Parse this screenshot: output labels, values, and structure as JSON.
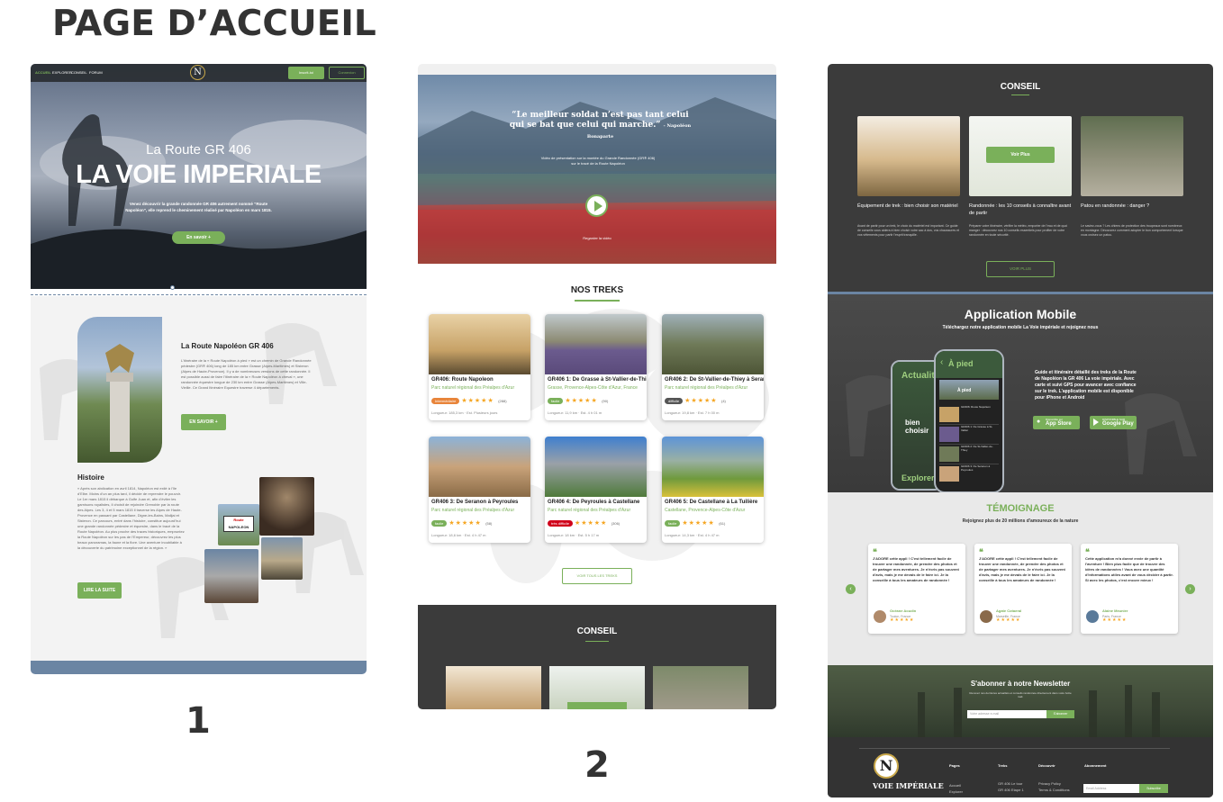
{
  "page_title": "PAGE D’ACCUEIL",
  "labels": {
    "one": "1",
    "two": "2"
  },
  "p1": {
    "nav": [
      "ACCUEIL",
      "EXPLORER",
      "CONSEIL",
      "FORUM"
    ],
    "logo": "N",
    "btn_signup": "Inscrit-toi",
    "btn_login": "Connexion",
    "hero_sub": "La Route GR 406",
    "hero_title": "LA VOIE IMPERIALE",
    "hero_text": "Venez découvrir la grande randonnée GR 406 autrement nommé “Route Napoléon”, elle reprend le cheminement réalisé par Napoléon en mars 1815.",
    "hero_btn": "En savoir +",
    "about_title": "La Route Napoléon GR 406",
    "about_text": "L’itinéraire de la « Route Napoléon à pied » est un chemin de Grande Randonnée pédestre (GR® 406) long de 185 km entre Grasse (Alpes-Maritimes) et Sisteron (Alpes de Haute-Provence). Il y a de nombreuses versions de cette randonnée. Il est possible aussi de faire l’itinéraire de la « Route Napoléon à cheval », une randonnée équestre longue de 230 km entre Grasse (Alpes-Maritimes) et Ville-Vieille. Ce Grand Itinéraire Equestre traverse 4 départements.",
    "about_btn": "EN SAVOIR +",
    "hist_title": "Histoire",
    "hist_text": "« Après son abdication en avril 1814, Napoléon est exilé à l’île d’Elbe. Moins d’un an plus tard, il décide de reprendre le pouvoir. Le 1er mars 1815 il débarque à Golfe Juan et, afin d’éviter les garnisons royalistes, il choisit de rejoindre Grenoble par la route des Alpes. Les 3, 4 et 5 mars 1815 il traverse les Alpes de Haute-Provence en passant par Castellane, Digne-les-Bains, Malijai et Sisteron. Ce parcours, entré dans l’histoire, constitue aujourd’hui une grande randonnée pédestre et équestre, dans le tracé de la Route Napoléon. Au plus proche des traces historiques, empruntez la Route Napoléon sur les pas de l’Empereur, découvrez les plus beaux panoramas, la faune et la flore. Une aventure inoubliable à la découverte du patrimoine exceptionnel de la région. »",
    "hist_btn": "LIRE LA SUITE",
    "sign_line1": "Route",
    "sign_line2": "NAPOLEON"
  },
  "p2": {
    "quote": "“Le meilleur soldat n’est pas tant celui qui se bat que celui qui marche.”",
    "quote_author": "- Napoléon Bonaparte",
    "video_caption": "Vidéo de présentation sur la montée du Grande Randonnée (GR® 406) sur le tracé de la Route Napoléon",
    "video_label": "Regarder la vidéo",
    "treks_title": "NOS TREKS",
    "treks": [
      {
        "title": "GR406: Route Napoleon",
        "region": "Parc naturel régional des Préalpes d'Azur",
        "level": "Intermédiaire",
        "level_color": "#e8843a",
        "rating": "(288)",
        "meta": "Longueur: 185,3 km · Est. Plusieurs jours"
      },
      {
        "title": "GR406 1: De Grasse à St-Vallier-de-Thiey",
        "region": "Grasse, Provence-Alpes-Côte d'Azur, France",
        "level": "facile",
        "level_color": "#7ab05a",
        "rating": "(90)",
        "meta": "Longueur: 11,9 km · Est. 4 h 01 m"
      },
      {
        "title": "GR406 2: De St-Vallier-de-Thiey à Seranon",
        "region": "Parc naturel régional des Préalpes d'Azur",
        "level": "difficile",
        "level_color": "#555555",
        "rating": "(4)",
        "meta": "Longueur: 19,8 km · Est. 7 h 00 m"
      },
      {
        "title": "GR406 3: De Seranon à Peyroules",
        "region": "Parc naturel régional des Préalpes d'Azur",
        "level": "facile",
        "level_color": "#7ab05a",
        "rating": "(58)",
        "meta": "Longueur: 18,6 km · Est. 4 h 47 m"
      },
      {
        "title": "GR406 4: De Peyroules à Castellane",
        "region": "Parc naturel régional des Préalpes d'Azur",
        "level": "très difficile",
        "level_color": "#d0021b",
        "rating": "(306)",
        "meta": "Longueur: 18 km · Est. 5 h 17 m"
      },
      {
        "title": "GR406 5: De Castellane à La Tuilière",
        "region": "Castellane, Provence-Alpes-Côte d'Azur",
        "level": "facile",
        "level_color": "#7ab05a",
        "rating": "(61)",
        "meta": "Longueur: 14,3 km · Est. 4 h 47 m"
      }
    ],
    "treks_btn": "VOIR TOUS LES TREKS",
    "conseil_title": "CONSEIL"
  },
  "p3": {
    "conseil_title": "CONSEIL",
    "articles": [
      {
        "title": "Équipement de trek : bien choisir son matériel",
        "text": "Avant de partir pour un trek, le choix du matériel est important. Ce guide de conseils vous aidera à bien choisir votre sac à dos, vos chaussures et vos vêtements pour partir l’esprit tranquille."
      },
      {
        "title": "Randonnée : les 10 conseils à connaître avant de partir",
        "text": "Préparer votre itinéraire, vérifier la météo, emporter de l’eau et de quoi manger : découvrez nos 10 conseils essentiels pour profiter de votre randonnée en toute sécurité."
      },
      {
        "title": "Patou en randonnée : danger ?",
        "text": "Le saviez-vous ? Les chiens de protection des troupeaux sont nombreux en montagne. Découvrez comment adopter le bon comportement lorsque vous croisez un patou."
      }
    ],
    "voir_plus": "Voir Plus",
    "voir_plus_btn": "VOIR PLUS",
    "app_title": "Application Mobile",
    "app_sub": "Téléchargez notre application mobile La Voie impériale et rejoignez nous",
    "app_text": "Guide et itinéraire détaillé des treks de la Route de Napoléon la GR 406 La voie impériale. Avec carte et suivi GPS pour avancer avec confiance sur le trek. L’application mobile est disponible pour iPhone et Android",
    "phone1_title": "Actualités",
    "phone1_sub": "bien choisir",
    "phone1_bottom": "Explorer",
    "phone2_title": "À pied",
    "phone2_sub": "À pied",
    "phone2_items": [
      "GR406: Route Napoléon",
      "GR406 1: De Grasse à St-Vallier",
      "GR406 2: De St-Vallier-de-Thiey",
      "GR406 3: De Seranon à Peyroules"
    ],
    "appstore_small": "Disponible sur",
    "appstore": "App Store",
    "gplay_small": "DISPONIBLE SUR",
    "gplay": "Google Play",
    "temo_title": "TÉMOIGNAGE",
    "temo_sub": "Rejoignez plus de 20 millions d'amoureux de la nature",
    "testimonials": [
      {
        "text": "J'ADORE cette appli ! C'est tellement facile de trouver une randonnée, de prendre des photos et de partager mes aventures. Je n'écris pas souvent d'avis, mais je me devais de le faire ici. Je la conseille à tous les amateurs de randonnée !",
        "name": "Océane Aoudin",
        "city": "Toulon, France"
      },
      {
        "text": "J'ADORE cette appli ! C'est tellement facile de trouver une randonnée, de prendre des photos et de partager mes aventures. Je n'écris pas souvent d'avis, mais je me devais de le faire ici. Je la conseille à tous les amateurs de randonnée !",
        "name": "Agate Cotaeral",
        "city": "Marseille, France"
      },
      {
        "text": "Cette application m'a donné envie de partir à l'aventure ! Bien plus facile que de trouver des idées de randonnées ! Vous avez une quantité d'informations utiles avant de vous décider à partir. Si avec les photos, c'est encore mieux !",
        "name": "Alaine Meunier",
        "city": "Paris, France"
      }
    ],
    "stars": "★★★★★",
    "news_title": "S'abonner à notre Newsletter",
    "news_text": "Recevez nos dernières actualités et conseils randonnée directement dans votre boîte mail.",
    "news_placeholder": "Votre adresse e-mail",
    "news_btn": "S'abonner",
    "footer_brand": "VOIE IMPÉRIALE",
    "footer_logo": "N",
    "footer_cols": [
      {
        "title": "Pages",
        "links": [
          "Accueil",
          "Explorer"
        ]
      },
      {
        "title": "Treks",
        "links": [
          "GR 406 Le tour",
          "GR 406 Etape 1"
        ]
      },
      {
        "title": "Découvrir",
        "links": [
          "Privacy Policy",
          "Terms & Conditions"
        ]
      },
      {
        "title": "Abonnement",
        "links": []
      }
    ],
    "footer_input": "Email Address",
    "footer_btn": "Subscribe"
  },
  "colors": {
    "green": "#7ab05a",
    "dark": "#3b3b3b",
    "blue": "#6b85a3"
  }
}
